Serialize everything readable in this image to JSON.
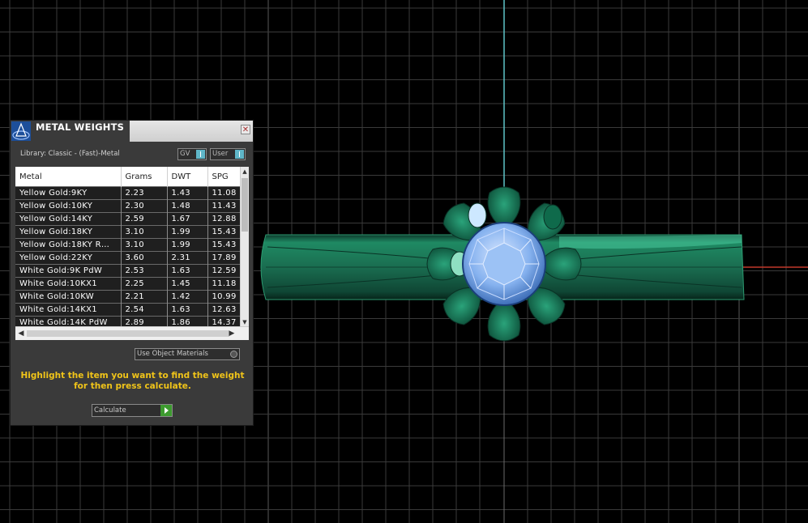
{
  "panel": {
    "title": "METAL WEIGHTS",
    "close_icon": "close-icon",
    "library_label": "Library: Classic - (Fast)-Metal",
    "toggles": {
      "gv": "GV",
      "user": "User"
    },
    "columns": [
      "Metal",
      "Grams",
      "DWT",
      "SPG"
    ],
    "rows": [
      [
        "Yellow Gold:9KY",
        "2.23",
        "1.43",
        "11.08"
      ],
      [
        "Yellow Gold:10KY",
        "2.30",
        "1.48",
        "11.43"
      ],
      [
        "Yellow Gold:14KY",
        "2.59",
        "1.67",
        "12.88"
      ],
      [
        "Yellow Gold:18KY",
        "3.10",
        "1.99",
        "15.43"
      ],
      [
        "Yellow Gold:18KY R…",
        "3.10",
        "1.99",
        "15.43"
      ],
      [
        "Yellow Gold:22KY",
        "3.60",
        "2.31",
        "17.89"
      ],
      [
        "White Gold:9K PdW",
        "2.53",
        "1.63",
        "12.59"
      ],
      [
        "White Gold:10KX1",
        "2.25",
        "1.45",
        "11.18"
      ],
      [
        "White Gold:10KW",
        "2.21",
        "1.42",
        "10.99"
      ],
      [
        "White Gold:14KX1",
        "2.54",
        "1.63",
        "12.63"
      ],
      [
        "White Gold:14K PdW",
        "2.89",
        "1.86",
        "14.37"
      ]
    ],
    "use_object_materials": "Use Object Materials",
    "hint": "Highlight the item you want to find the weight for then press calculate.",
    "calculate_label": "Calculate"
  },
  "colors": {
    "ring": "#1e7a5a",
    "gem": "#7fb0ee",
    "hint": "#f0c419",
    "axis_v": "#5ec4c8",
    "axis_h": "#c0392b"
  }
}
